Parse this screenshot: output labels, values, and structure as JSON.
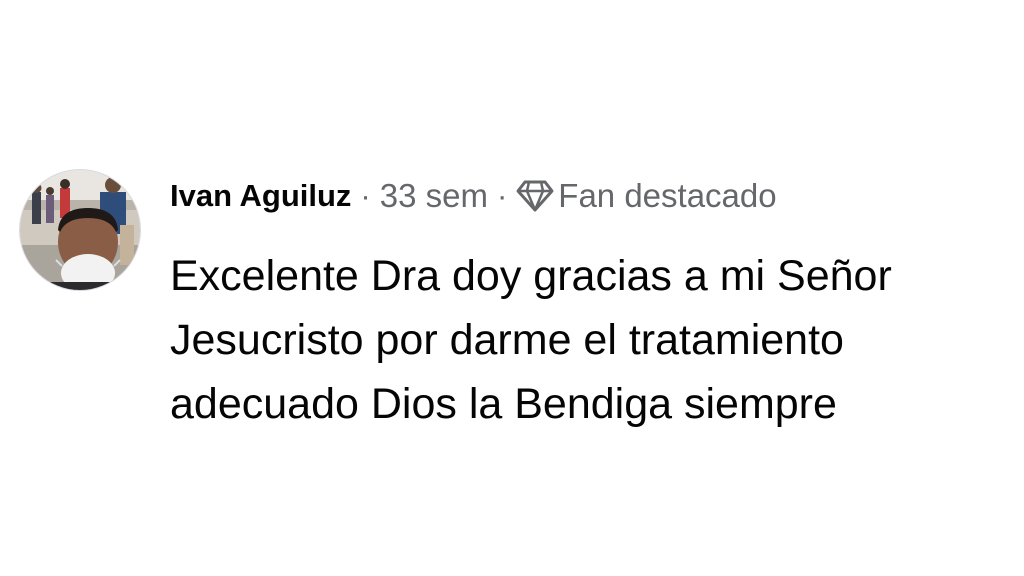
{
  "comment": {
    "author": "Ivan Aguiluz",
    "separator": "·",
    "time": "33 sem",
    "badge": {
      "icon": "diamond-icon",
      "label": "Fan destacado"
    },
    "text": "Excelente Dra doy gracias a mi Señor Jesucristo por darme el tratamiento adecuado Dios la Bendiga siempre"
  },
  "colors": {
    "text_primary": "#050505",
    "text_secondary": "#65676b",
    "background": "#ffffff"
  }
}
